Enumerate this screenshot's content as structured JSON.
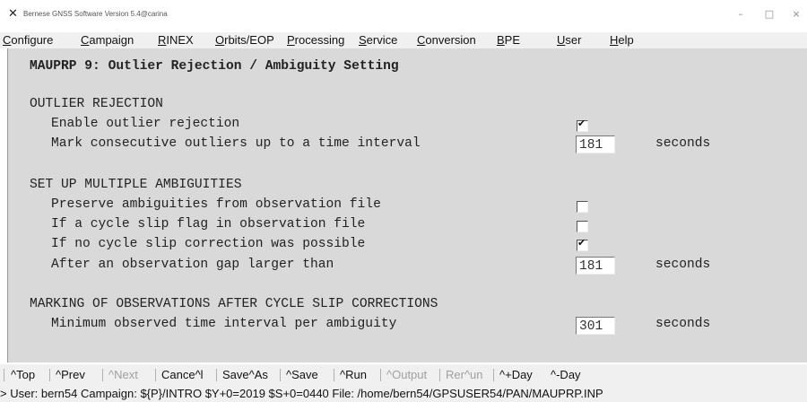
{
  "window": {
    "title": "Bernese GNSS Software Version 5.4@carina",
    "icon": "x-app-icon",
    "minimize": "–",
    "maximize": "□",
    "close": "×"
  },
  "menu": [
    {
      "label": "Configure"
    },
    {
      "label": "Campaign"
    },
    {
      "label": "RINEX"
    },
    {
      "label": "Orbits/EOP"
    },
    {
      "label": "Processing"
    },
    {
      "label": "Service"
    },
    {
      "label": "Conversion"
    },
    {
      "label": "BPE"
    },
    {
      "label": "User"
    },
    {
      "label": "Help"
    }
  ],
  "panel": {
    "heading": "MAUPRP 9: Outlier Rejection / Ambiguity Setting",
    "outlier": {
      "section": "OUTLIER REJECTION",
      "enable_label": "Enable outlier rejection",
      "enable_checked": true,
      "interval_label": "Mark consecutive outliers up to a time interval",
      "interval_value": "181",
      "interval_unit": "seconds"
    },
    "ambiguities": {
      "section": "SET UP MULTIPLE AMBIGUITIES",
      "preserve_label": "Preserve ambiguities from observation file",
      "preserve_checked": false,
      "cycleslip_flag_label": "If a cycle slip flag in observation file",
      "cycleslip_flag_checked": false,
      "no_correction_label": "If no cycle slip correction was possible",
      "no_correction_checked": true,
      "gap_label": "After an observation gap larger than",
      "gap_value": "181",
      "gap_unit": "seconds"
    },
    "marking": {
      "section": "MARKING OF OBSERVATIONS AFTER CYCLE SLIP CORRECTIONS",
      "min_label": "Minimum observed time interval per ambiguity",
      "min_value": "301",
      "min_unit": "seconds"
    }
  },
  "toolbar": {
    "top": "^Top",
    "prev": "^Prev",
    "next": "^Next",
    "cancel": "Cance^l",
    "saveas": "Save^As",
    "save": "^Save",
    "run": "^Run",
    "output": "^Output",
    "rerun": "Rer^un",
    "plusday": "^+Day",
    "minusday": "^-Day"
  },
  "status": "> User: bern54  Campaign: ${P}/INTRO  $Y+0=2019  $S+0=0440  File: /home/bern54/GPSUSER54/PAN/MAUPRP.INP"
}
